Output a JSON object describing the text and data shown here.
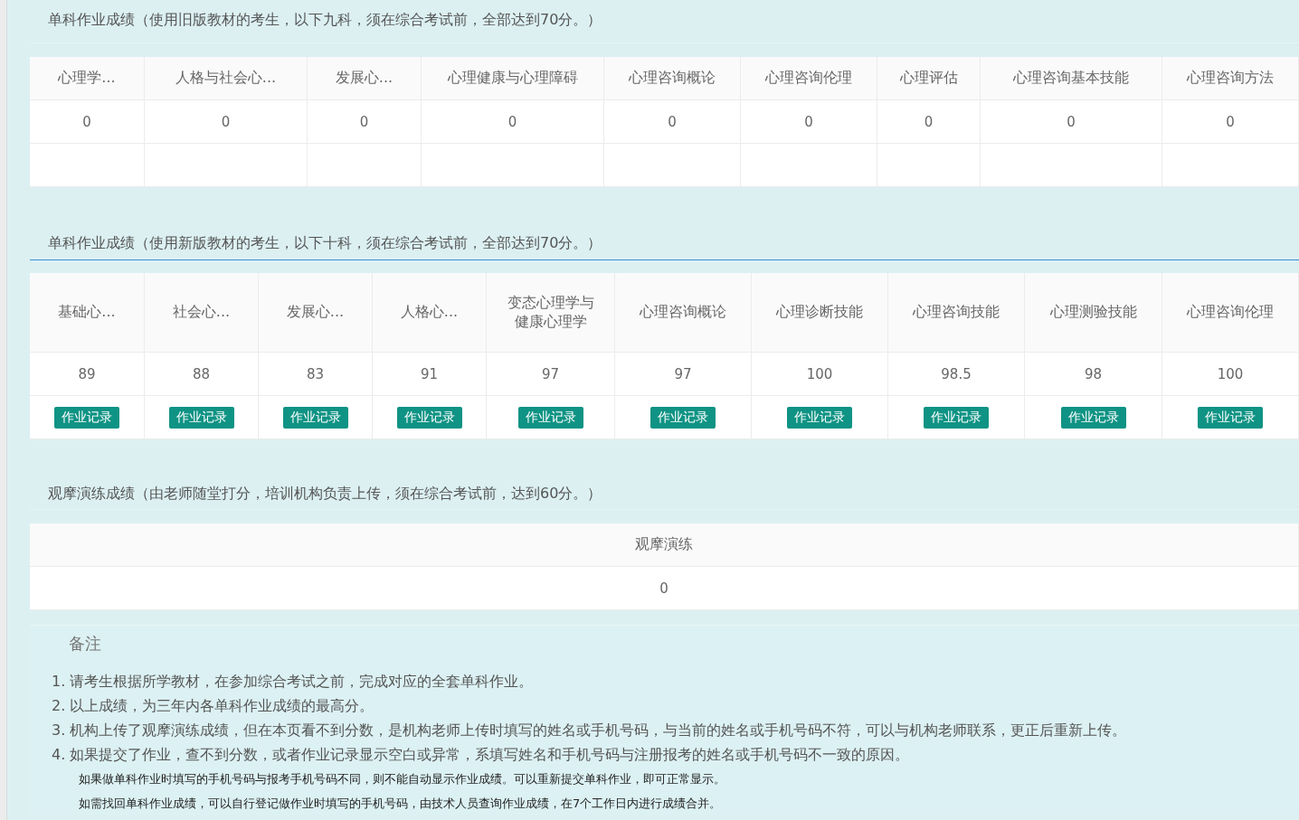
{
  "sections": [
    {
      "kind": "plain",
      "title": "单科作业成绩（使用旧版教材的考生，以下九科，须在综合考试前，全部达到70分。）",
      "underline": false,
      "subjects": [
        {
          "name": "心理学...",
          "score": "0"
        },
        {
          "name": "人格与社会心...",
          "score": "0"
        },
        {
          "name": "发展心...",
          "score": "0"
        },
        {
          "name": "心理健康与心理障碍",
          "score": "0"
        },
        {
          "name": "心理咨询概论",
          "score": "0"
        },
        {
          "name": "心理咨询伦理",
          "score": "0"
        },
        {
          "name": "心理评估",
          "score": "0"
        },
        {
          "name": "心理咨询基本技能",
          "score": "0"
        },
        {
          "name": "心理咨询方法",
          "score": "0"
        }
      ]
    },
    {
      "kind": "records",
      "title": "单科作业成绩（使用新版教材的考生，以下十科，须在综合考试前，全部达到70分。）",
      "underline": true,
      "subjects": [
        {
          "name": "基础心...",
          "score": "89",
          "button": "作业记录"
        },
        {
          "name": "社会心...",
          "score": "88",
          "button": "作业记录"
        },
        {
          "name": "发展心...",
          "score": "83",
          "button": "作业记录"
        },
        {
          "name": "人格心...",
          "score": "91",
          "button": "作业记录"
        },
        {
          "name": "变态心理学与健康心理学",
          "score": "97",
          "button": "作业记录"
        },
        {
          "name": "心理咨询概论",
          "score": "97",
          "button": "作业记录"
        },
        {
          "name": "心理诊断技能",
          "score": "100",
          "button": "作业记录"
        },
        {
          "name": "心理咨询技能",
          "score": "98.5",
          "button": "作业记录"
        },
        {
          "name": "心理测验技能",
          "score": "98",
          "button": "作业记录"
        },
        {
          "name": "心理咨询伦理",
          "score": "100",
          "button": "作业记录"
        }
      ]
    },
    {
      "kind": "single",
      "title": "观摩演练成绩（由老师随堂打分，培训机构负责上传，须在综合考试前，达到60分。）",
      "underline": false,
      "subjects": [
        {
          "name": "观摩演练",
          "score": "0"
        }
      ]
    }
  ],
  "notes": {
    "title": "备注",
    "items": [
      "1. 请考生根据所学教材，在参加综合考试之前，完成对应的全套单科作业。",
      "2. 以上成绩，为三年内各单科作业成绩的最高分。",
      "3. 机构上传了观摩演练成绩，但在本页看不到分数，是机构老师上传时填写的姓名或手机号码，与当前的姓名或手机号码不符，可以与机构老师联系，更正后重新上传。",
      "4. 如果提交了作业，查不到分数，或者作业记录显示空白或异常，系填写姓名和手机号码与注册报考的姓名或手机号码不一致的原因。"
    ],
    "details": [
      "如果做单科作业时填写的手机号码与报考手机号码不同，则不能自动显示作业成绩。可以重新提交单科作业，即可正常显示。",
      "如需找回单科作业成绩，可以自行登记做作业时填写的手机号码，由技术人员查询作业成绩，在7个工作日内进行成绩合并。"
    ]
  }
}
